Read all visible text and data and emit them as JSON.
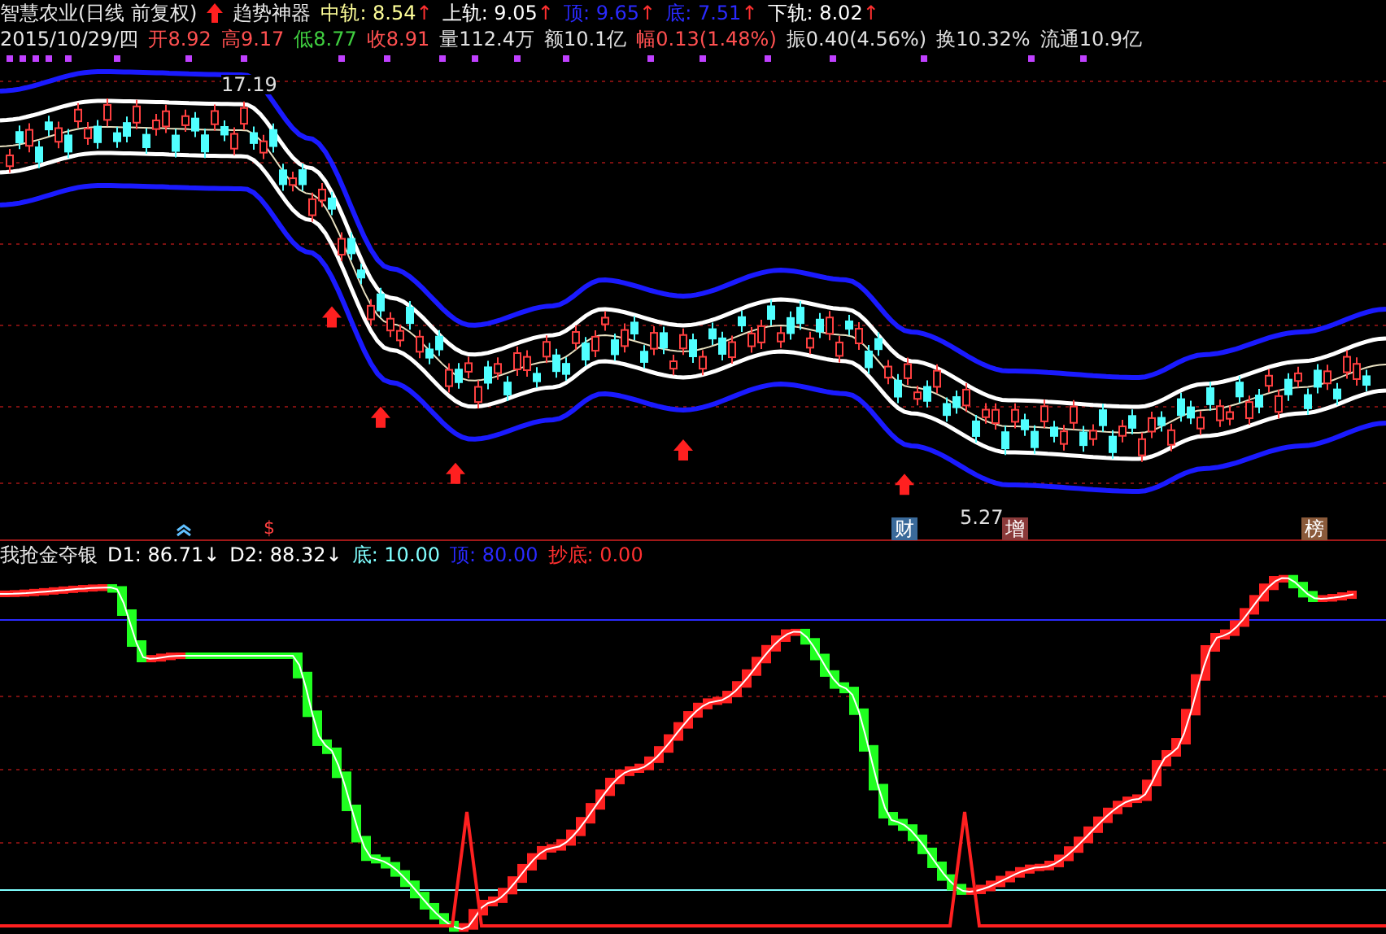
{
  "price_panel": {
    "stock": "智慧农业(日线 前复权)",
    "indicator": "趋势神器",
    "lines": [
      {
        "label": "中轨:",
        "value": "8.54",
        "arrow": "↑",
        "color": "#ffff99"
      },
      {
        "label": "上轨:",
        "value": "9.05",
        "arrow": "↑",
        "color": "#ffffff"
      },
      {
        "label": "顶:",
        "value": "9.65",
        "arrow": "↑",
        "color": "#2a2aff"
      },
      {
        "label": "底:",
        "value": "7.51",
        "arrow": "↑",
        "color": "#2a2aff"
      },
      {
        "label": "下轨:",
        "value": "8.02",
        "arrow": "↑",
        "color": "#ffffff"
      }
    ],
    "date": "2015/10/29/四",
    "quote": [
      {
        "label": "开",
        "value": "8.92",
        "color": "#ff5050"
      },
      {
        "label": "高",
        "value": "9.17",
        "color": "#ff5050"
      },
      {
        "label": "低",
        "value": "8.77",
        "color": "#40d040"
      },
      {
        "label": "收",
        "value": "8.91",
        "color": "#ff5050"
      },
      {
        "label": "量",
        "value": "112.4万",
        "color": "#e0e0e0"
      },
      {
        "label": "额",
        "value": "10.1亿",
        "color": "#e0e0e0"
      },
      {
        "label": "幅",
        "value": "0.13(1.48%)",
        "color": "#ff5050"
      },
      {
        "label": "振",
        "value": "0.40(4.56%)",
        "color": "#e0e0e0"
      },
      {
        "label": "换",
        "value": "10.32%",
        "color": "#e0e0e0"
      },
      {
        "label": "流通",
        "value": "10.9亿",
        "color": "#e0e0e0"
      }
    ],
    "high_label": "17.19",
    "low_label": "5.27",
    "events": [
      {
        "text": "财",
        "color": "#3a6a9a"
      },
      {
        "text": "增",
        "color": "#8a3a3a"
      },
      {
        "text": "榜",
        "color": "#8a5a3a"
      }
    ],
    "marker": "$"
  },
  "oscillator_panel": {
    "name": "我抢金夺银",
    "lines": [
      {
        "label": "D1:",
        "value": "86.71",
        "arrow": "↓",
        "color": "#ffffff"
      },
      {
        "label": "D2:",
        "value": "88.32",
        "arrow": "↓",
        "color": "#ffffff"
      },
      {
        "label": "底:",
        "value": "10.00",
        "color": "#80ffff"
      },
      {
        "label": "顶:",
        "value": "80.00",
        "color": "#2a2aff"
      },
      {
        "label": "抄底:",
        "value": "0.00",
        "color": "#ff3030"
      }
    ]
  }
}
